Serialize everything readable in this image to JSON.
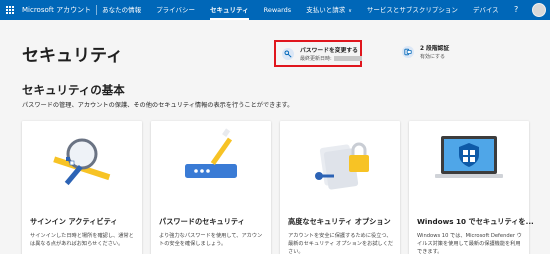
{
  "nav": {
    "brand": "Microsoft アカウント",
    "items": [
      {
        "label": "あなたの情報",
        "active": false
      },
      {
        "label": "プライバシー",
        "active": false
      },
      {
        "label": "セキュリティ",
        "active": true
      },
      {
        "label": "Rewards",
        "active": false
      },
      {
        "label": "支払いと請求",
        "active": false,
        "dropdown": true
      },
      {
        "label": "サービスとサブスクリプション",
        "active": false
      },
      {
        "label": "デバイス",
        "active": false
      }
    ],
    "help": "?"
  },
  "page": {
    "title": "セキュリティ"
  },
  "quick_actions": [
    {
      "title": "パスワードを変更する",
      "subtitle": "最終更新日時:",
      "icon": "key-icon"
    },
    {
      "title": "2 段階認証",
      "subtitle": "有効にする",
      "icon": "verification-icon"
    }
  ],
  "section": {
    "title": "セキュリティの基本",
    "description": "パスワードの管理、アカウントの保護、その他のセキュリティ情報の表示を行うことができます。"
  },
  "cards": [
    {
      "title": "サインイン アクティビティ",
      "body": "サインインした日時と場所を確認し、通常とは異なる点があればお知らせください。",
      "icon": "magnifier-icon"
    },
    {
      "title": "パスワードのセキュリティ",
      "body": "より強力なパスワードを使用して、アカウントの安全を確保しましょう。",
      "icon": "password-icon"
    },
    {
      "title": "高度なセキュリティ オプション",
      "body": "アカウントを安全に保護するために役立つ、最新のセキュリティ オプションをお試しください。",
      "icon": "lock-icon"
    },
    {
      "title": "Windows 10 でセキュリティを...",
      "body": "Windows 10 では、Microsoft Defender ウイルス対策を使用して最新の保護機能を利用できます。",
      "icon": "windows-shield-icon"
    }
  ],
  "colors": {
    "nav_bg": "#0067b8",
    "highlight_border": "#e0161d",
    "accent_yellow": "#f7c325",
    "accent_blue": "#0078d4"
  }
}
